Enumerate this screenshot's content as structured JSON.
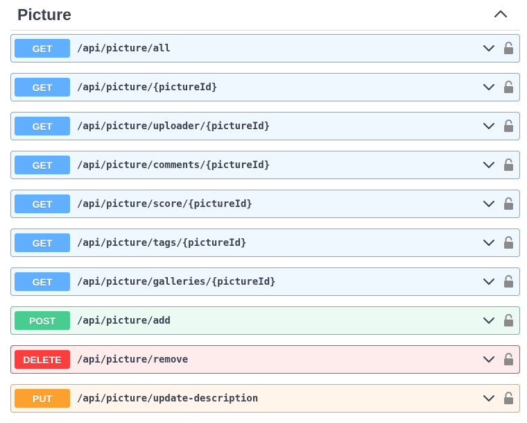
{
  "section": {
    "title": "Picture",
    "expanded": true
  },
  "colors": {
    "get": "#61affe",
    "post": "#49cc90",
    "delete": "#f93e3e",
    "put": "#fca130",
    "text": "#3b4151",
    "icon": "#3b4151",
    "lock": "#8a8a8a"
  },
  "icons": {
    "collapse": "chevron-up-icon",
    "expand": "chevron-down-icon",
    "auth": "unlocked-padlock-icon"
  },
  "operations": [
    {
      "method": "GET",
      "path": "/api/picture/all"
    },
    {
      "method": "GET",
      "path": "/api/picture/{pictureId}"
    },
    {
      "method": "GET",
      "path": "/api/picture/uploader/{pictureId}"
    },
    {
      "method": "GET",
      "path": "/api/picture/comments/{pictureId}"
    },
    {
      "method": "GET",
      "path": "/api/picture/score/{pictureId}"
    },
    {
      "method": "GET",
      "path": "/api/picture/tags/{pictureId}"
    },
    {
      "method": "GET",
      "path": "/api/picture/galleries/{pictureId}"
    },
    {
      "method": "POST",
      "path": "/api/picture/add"
    },
    {
      "method": "DELETE",
      "path": "/api/picture/remove"
    },
    {
      "method": "PUT",
      "path": "/api/picture/update-description"
    }
  ]
}
